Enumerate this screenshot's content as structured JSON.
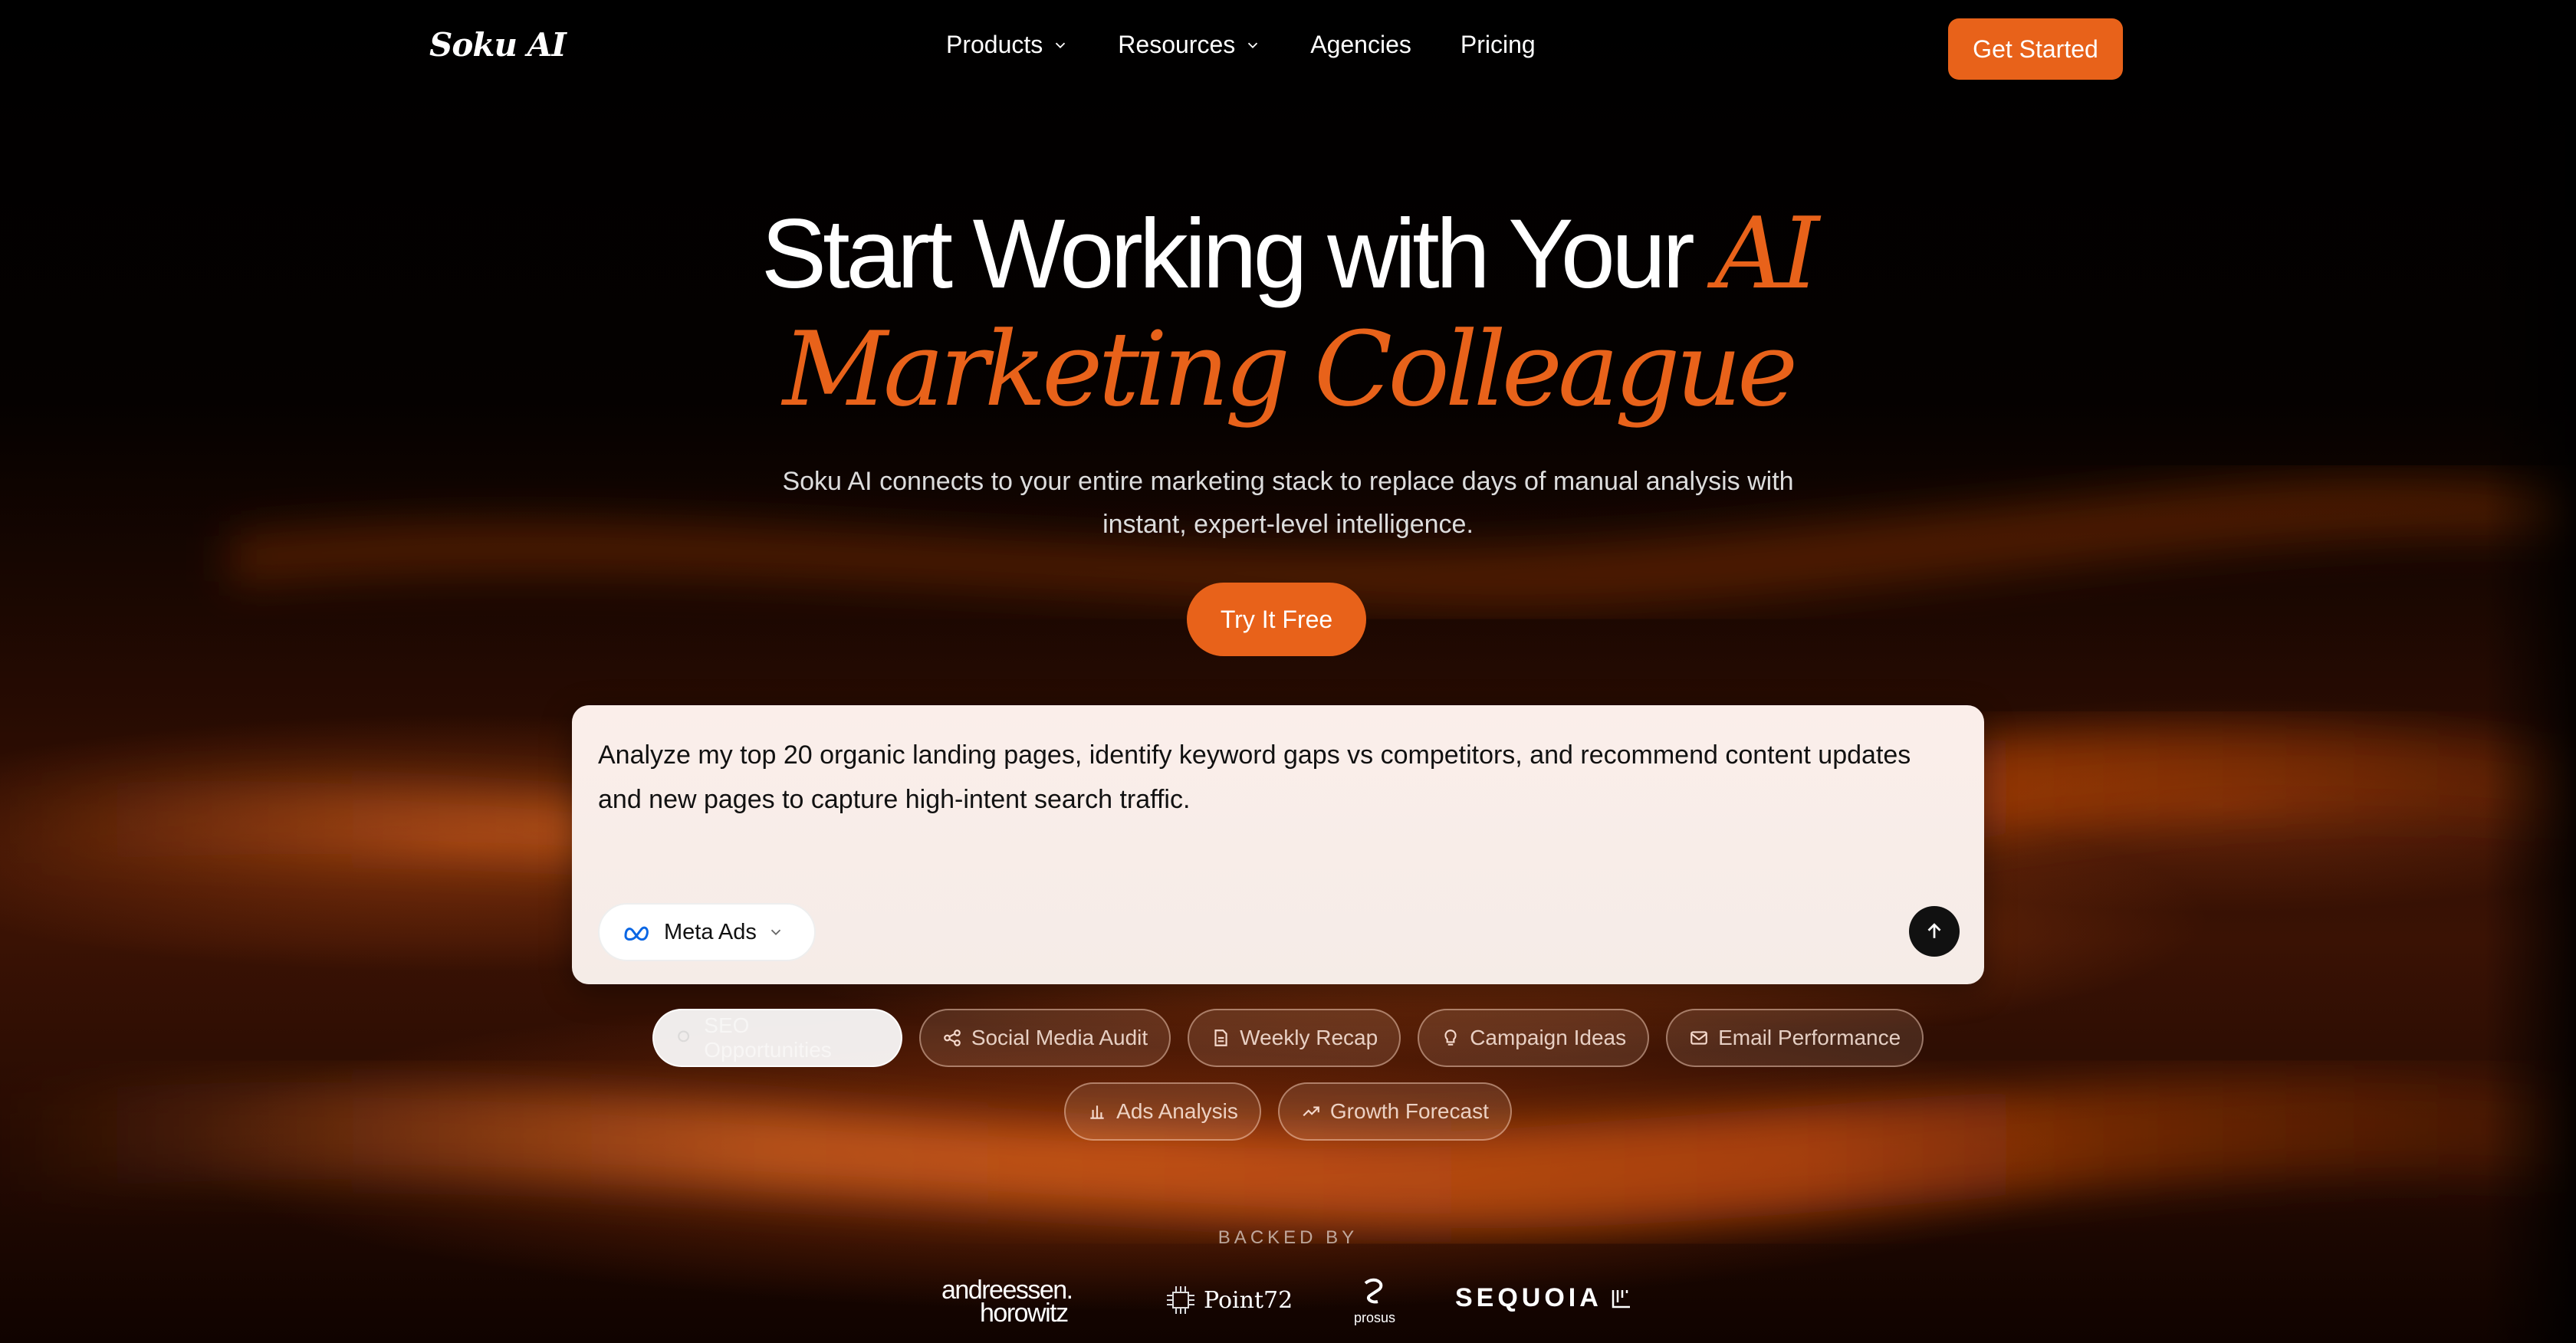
{
  "nav": {
    "logo": "Soku AI",
    "links": [
      "Products",
      "Resources",
      "Agencies",
      "Pricing"
    ],
    "cta": "Get Started"
  },
  "hero": {
    "line1_plain": "Start Working with Your",
    "line1_accent": "AI",
    "line2_accent": "Marketing Colleague",
    "subtitle_line1": "Soku AI connects to your entire marketing stack to replace days of manual analysis with",
    "subtitle_line2": "instant, expert-level intelligence.",
    "cta": "Try It Free"
  },
  "prompt": {
    "text": "Analyze my top 20 organic landing pages, identify keyword gaps vs competitors, and recommend content updates and new pages to capture high-intent search traffic.",
    "source": "Meta Ads"
  },
  "chips": {
    "row1": [
      "SEO Opportunities",
      "Social Media Audit",
      "Weekly Recap",
      "Campaign Ideas",
      "Email Performance"
    ],
    "row2": [
      "Ads Analysis",
      "Growth Forecast"
    ]
  },
  "backed": {
    "label": "BACKED BY",
    "investors": [
      "andreessen.",
      "horowitz",
      "Point72",
      "prosus",
      "SEQUOIA"
    ]
  },
  "colors": {
    "accent": "#e8621a",
    "background": "#000000"
  }
}
